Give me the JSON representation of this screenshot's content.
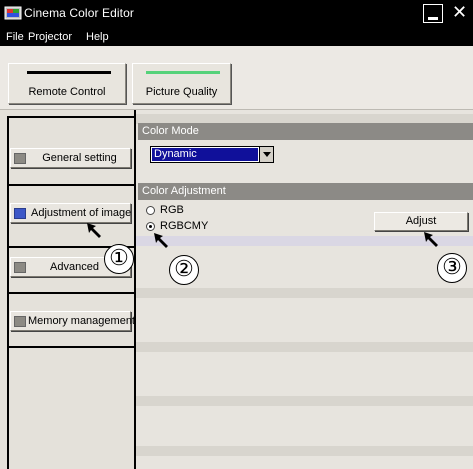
{
  "window": {
    "title": "Cinema Color Editor"
  },
  "menu": [
    "File",
    "Projector",
    "Help"
  ],
  "toolbar": {
    "remote_control": "Remote Control",
    "picture_quality": "Picture Quality"
  },
  "sidebar": {
    "items": [
      {
        "label": "General setting",
        "active": false
      },
      {
        "label": "Adjustment of image",
        "active": true
      },
      {
        "label": "Advanced",
        "active": false
      },
      {
        "label": "Memory management",
        "active": false
      }
    ]
  },
  "color_mode": {
    "header": "Color Mode",
    "selected": "Dynamic"
  },
  "color_adjustment": {
    "header": "Color Adjustment",
    "options": [
      "RGB",
      "RGBCMY"
    ],
    "selected": "RGBCMY",
    "adjust_label": "Adjust"
  },
  "callouts": [
    "①",
    "②",
    "③"
  ],
  "colors": {
    "title_bar": "#000000",
    "selection": "#10109a",
    "active_square": "#3c57c7",
    "indicator_green": "#55d27a",
    "header_gray": "#8c8a86"
  }
}
